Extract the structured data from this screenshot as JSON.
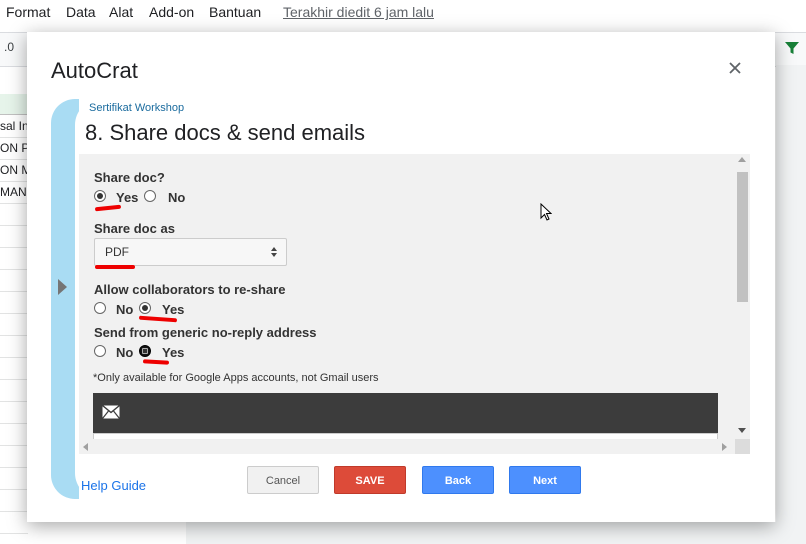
{
  "menubar": {
    "items": [
      "Format",
      "Data",
      "Alat",
      "Add-on",
      "Bantuan"
    ],
    "last_edit": "Terakhir diedit 6 jam lalu"
  },
  "toolbar": {
    "decimal_label": ".0"
  },
  "sheet": {
    "cells": [
      "sal In",
      "ON P",
      "ON M",
      "MAN"
    ]
  },
  "dialog": {
    "title": "AutoCrat",
    "close_icon": "close-icon",
    "subtitle": "Sertifikat Workshop",
    "step_title": "8. Share docs & send emails",
    "share_doc": {
      "label": "Share doc?",
      "yes": "Yes",
      "no": "No",
      "selected": "Yes"
    },
    "share_as": {
      "label": "Share doc as",
      "value": "PDF"
    },
    "reshare": {
      "label": "Allow collaborators to re-share",
      "no": "No",
      "yes": "Yes",
      "selected": "Yes"
    },
    "noreply": {
      "label": "Send from generic no-reply address",
      "no": "No",
      "yes": "Yes",
      "selected": "Yes"
    },
    "note": "*Only available for Google Apps accounts, not Gmail users",
    "email_icon": "envelope-icon",
    "help_link": "Help Guide",
    "buttons": {
      "cancel": "Cancel",
      "save": "SAVE",
      "back": "Back",
      "next": "Next"
    }
  },
  "colors": {
    "accent_blue": "#4d90fe",
    "save_red": "#dd4b39",
    "panel_blue": "#a9dcf3",
    "annotation_red": "#e00000"
  }
}
